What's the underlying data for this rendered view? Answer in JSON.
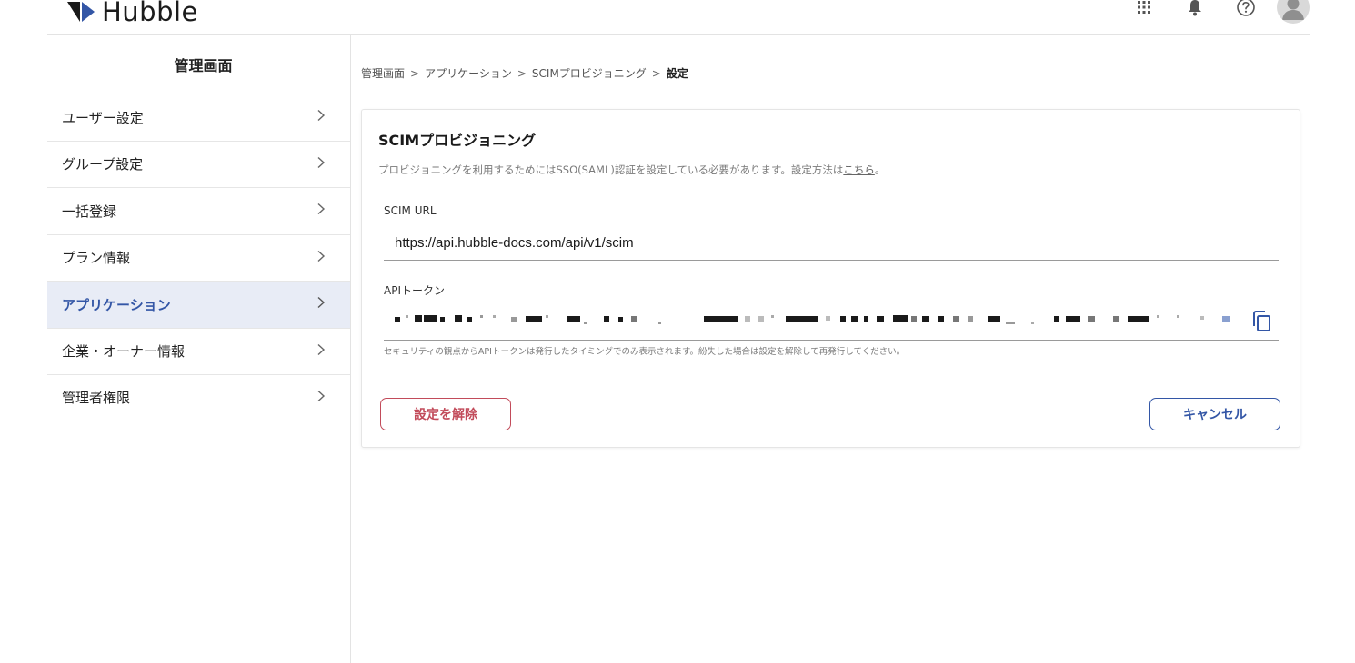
{
  "header": {
    "logo_text": "Hubble",
    "icons": [
      "apps-grid-icon",
      "bell-icon",
      "help-icon",
      "avatar-icon"
    ]
  },
  "sidebar": {
    "title": "管理画面",
    "items": [
      {
        "label": "ユーザー設定",
        "active": false
      },
      {
        "label": "グループ設定",
        "active": false
      },
      {
        "label": "一括登録",
        "active": false
      },
      {
        "label": "プラン情報",
        "active": false
      },
      {
        "label": "アプリケーション",
        "active": true
      },
      {
        "label": "企業・オーナー情報",
        "active": false
      },
      {
        "label": "管理者権限",
        "active": false
      }
    ]
  },
  "breadcrumb": {
    "items": [
      "管理画面",
      "アプリケーション",
      "SCIMプロビジョニング"
    ],
    "current": "設定",
    "separator": ">"
  },
  "card": {
    "title": "SCIMプロビジョニング",
    "description": "プロビジョニングを利用するためにはSSO(SAML)認証を設定している必要があります。設定方法は",
    "description_link": "こちら",
    "description_end": "。",
    "scim_url_label": "SCIM URL",
    "scim_url_value": "https://api.hubble-docs.com/api/v1/scim",
    "api_token_label": "APIトークン",
    "api_token_masked": true,
    "help_text": "セキュリティの観点からAPIトークンは発行したタイミングでのみ表示されます。紛失した場合は設定を解除して再発行してください。",
    "remove_button": "設定を解除",
    "cancel_button": "キャンセル"
  },
  "colors": {
    "accent": "#3356a6",
    "danger": "#c24b5a",
    "active_bg": "#e8ecf6"
  }
}
